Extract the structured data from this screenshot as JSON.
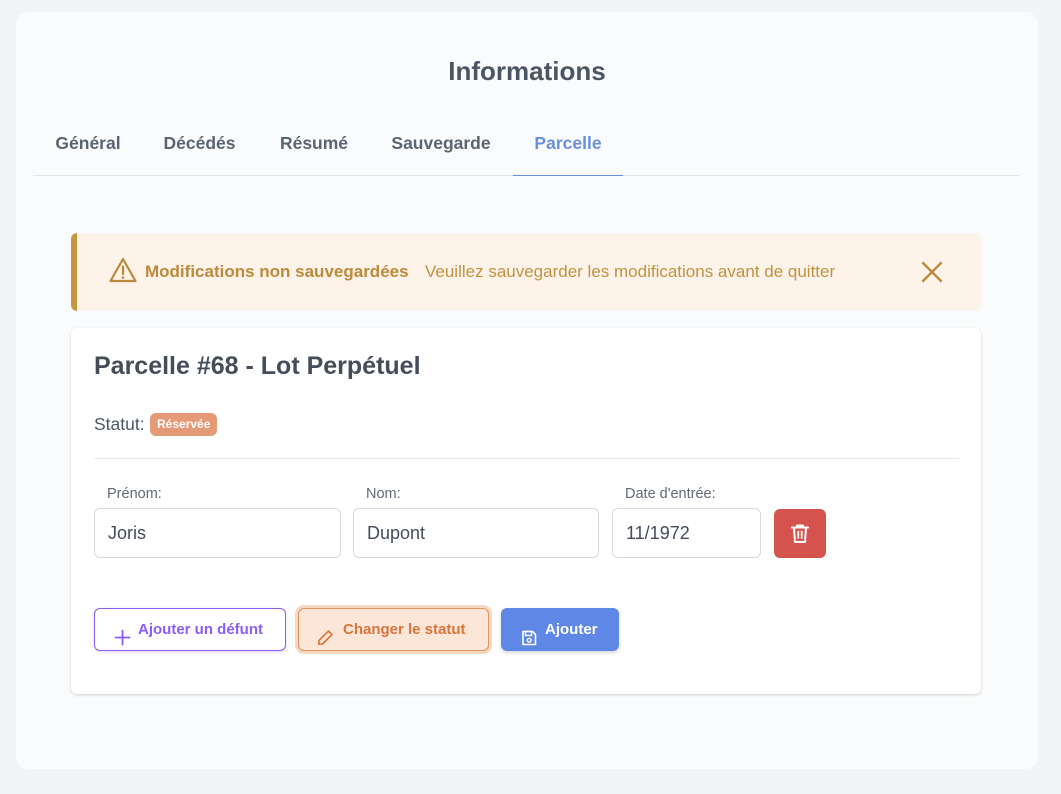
{
  "page": {
    "title": "Informations"
  },
  "tabs": [
    {
      "label": "Général"
    },
    {
      "label": "Décédés"
    },
    {
      "label": "Résumé"
    },
    {
      "label": "Sauvegarde"
    },
    {
      "label": "Parcelle"
    }
  ],
  "active_tab": "Parcelle",
  "alert": {
    "title": "Modifications non sauvegardées",
    "message": "Veuillez sauvegarder les modifications avant de quitter",
    "icon": "warning-icon",
    "color": "#c9963e"
  },
  "card": {
    "title": "Parcelle #68 - Lot Perpétuel",
    "status_label": "Statut:",
    "status_badge": "Réservée",
    "status_color": "#e59a77"
  },
  "form": {
    "prenom_label": "Prénom:",
    "prenom_value": "Joris",
    "nom_label": "Nom:",
    "nom_value": "Dupont",
    "date_label": "Date d'entrée:",
    "date_value": "11/1972"
  },
  "buttons": {
    "add_defunt": "Ajouter un défunt",
    "change_status": "Changer le statut",
    "ajouter": "Ajouter"
  },
  "colors": {
    "accent": "#6b8fdf",
    "danger": "#d5534d",
    "purple": "#8b5cf6",
    "primary": "#5f87e6"
  }
}
